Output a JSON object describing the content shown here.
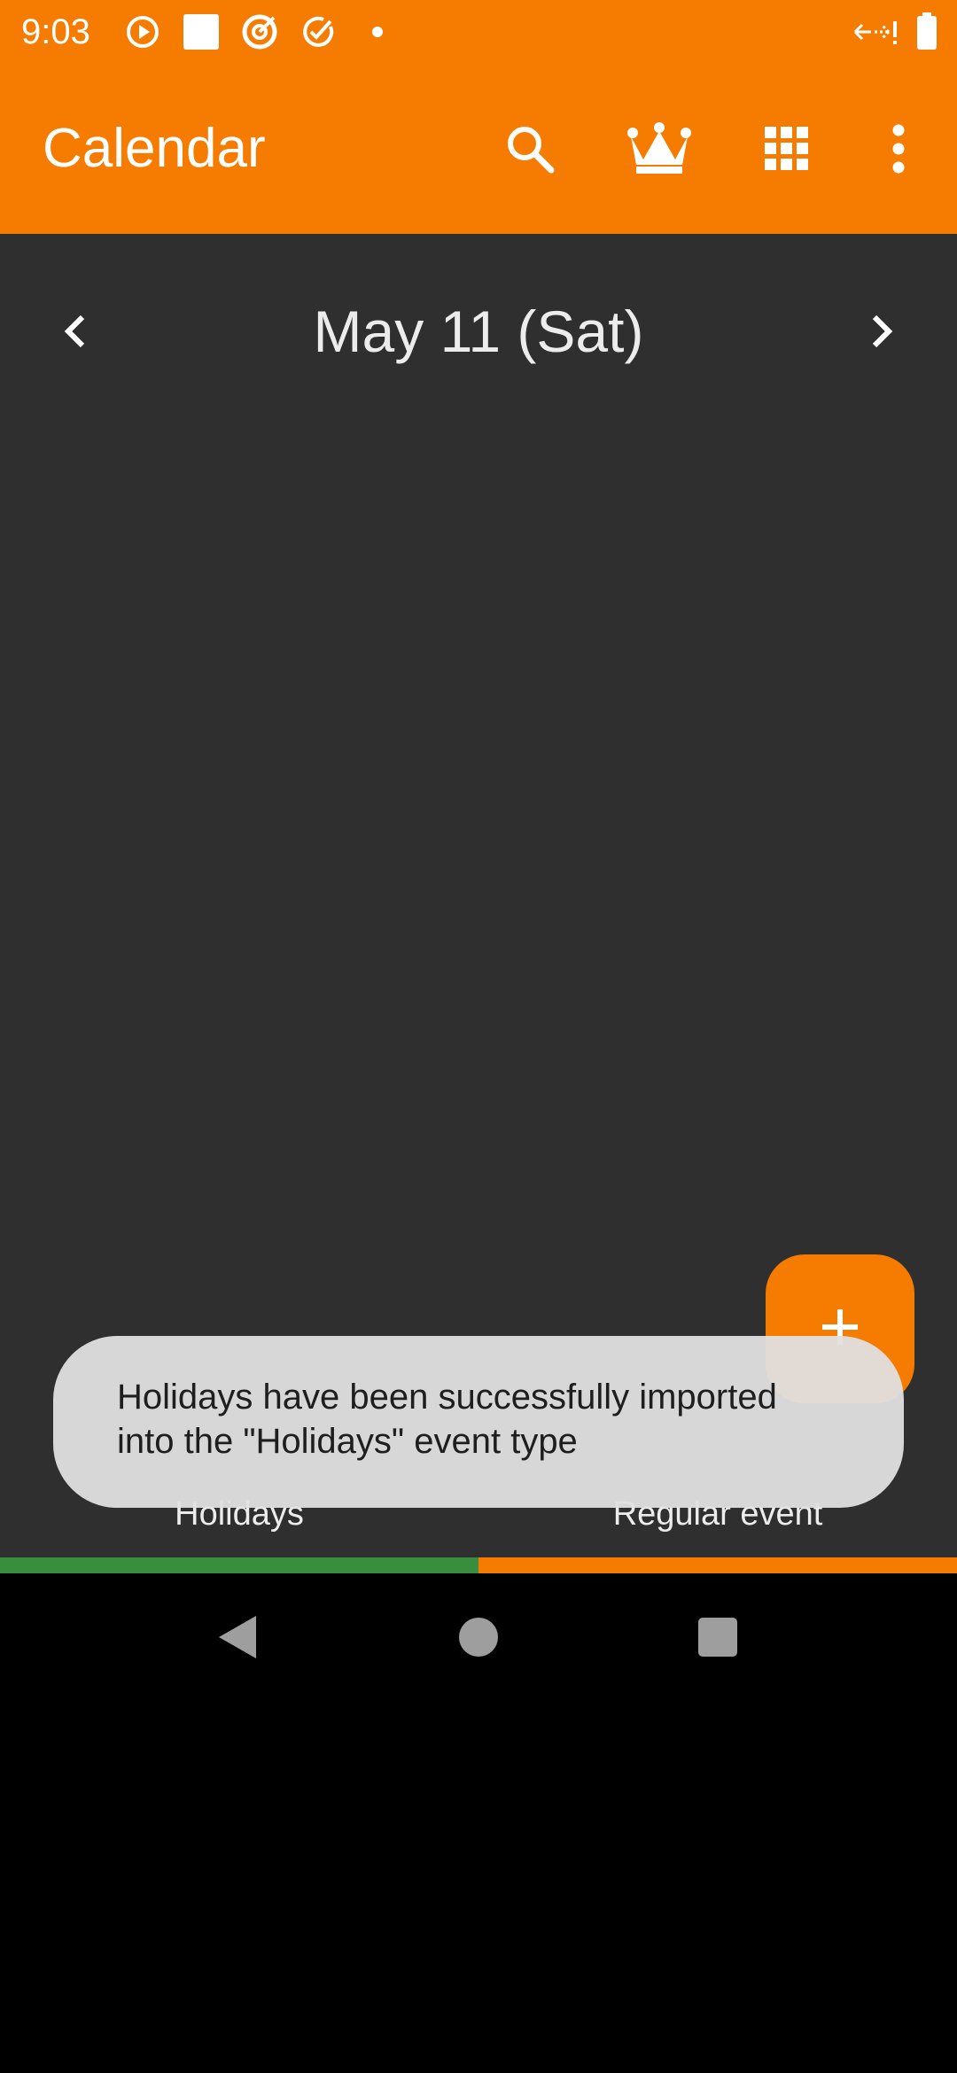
{
  "status_bar": {
    "time": "9:03",
    "left_icons": [
      "play-circle-icon",
      "square-icon",
      "target-icon",
      "check-circle-icon",
      "dot-icon"
    ],
    "right_icons": [
      "data-arrows-icon",
      "battery-icon"
    ]
  },
  "app_bar": {
    "title": "Calendar",
    "actions": [
      "search-icon",
      "crown-icon",
      "grid-icon",
      "more-vert-icon"
    ]
  },
  "day_view": {
    "date_label": "May 11 (Sat)",
    "prev_icon": "chevron-left-icon",
    "next_icon": "chevron-right-icon"
  },
  "event_types": {
    "tabs": [
      {
        "label": "Holidays",
        "color": "#388E3C"
      },
      {
        "label": "Regular event",
        "color": "#F57C00"
      }
    ]
  },
  "fab": {
    "icon": "plus-icon"
  },
  "toast": {
    "message": "Holidays have been successfully imported\ninto the \"Holidays\" event type"
  },
  "colors": {
    "accent": "#F57C00",
    "background": "#2F2F2F",
    "holidays": "#388E3C"
  },
  "system_nav": [
    "back-icon",
    "home-icon",
    "recents-icon"
  ]
}
